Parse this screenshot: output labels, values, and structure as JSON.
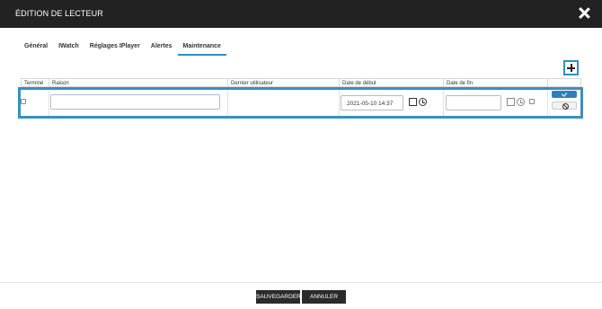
{
  "window": {
    "title": "ÉDITION DE LECTEUR",
    "close_icon": "close-icon"
  },
  "tabs": [
    {
      "label": "Général"
    },
    {
      "label": "IWatch"
    },
    {
      "label": "Réglages IPlayer"
    },
    {
      "label": "Alertes"
    },
    {
      "label": "Maintenance",
      "active": true
    }
  ],
  "table": {
    "columns": [
      "Terminé",
      "Raison",
      "Dernier utilisateur",
      "Date de début",
      "Date de fin"
    ],
    "row": {
      "termine_checked": false,
      "raison": "",
      "dernier_utilisateur": "",
      "date_debut": "2021-05-10 14:37",
      "date_fin": "",
      "date_fin_checked": false
    }
  },
  "icons": {
    "add": "plus-icon",
    "calendar": "calendar-icon",
    "clock": "clock-icon",
    "confirm": "checkmark-icon",
    "cancel": "cancel-icon"
  },
  "footer": {
    "save_label": "SAUVEGARDER",
    "cancel_label": "ANNULER"
  },
  "colors": {
    "titlebar": "#222222",
    "accent": "#2f8fc9",
    "confirm_button": "#2f7fbf",
    "footer_button": "#2b2b2b"
  }
}
